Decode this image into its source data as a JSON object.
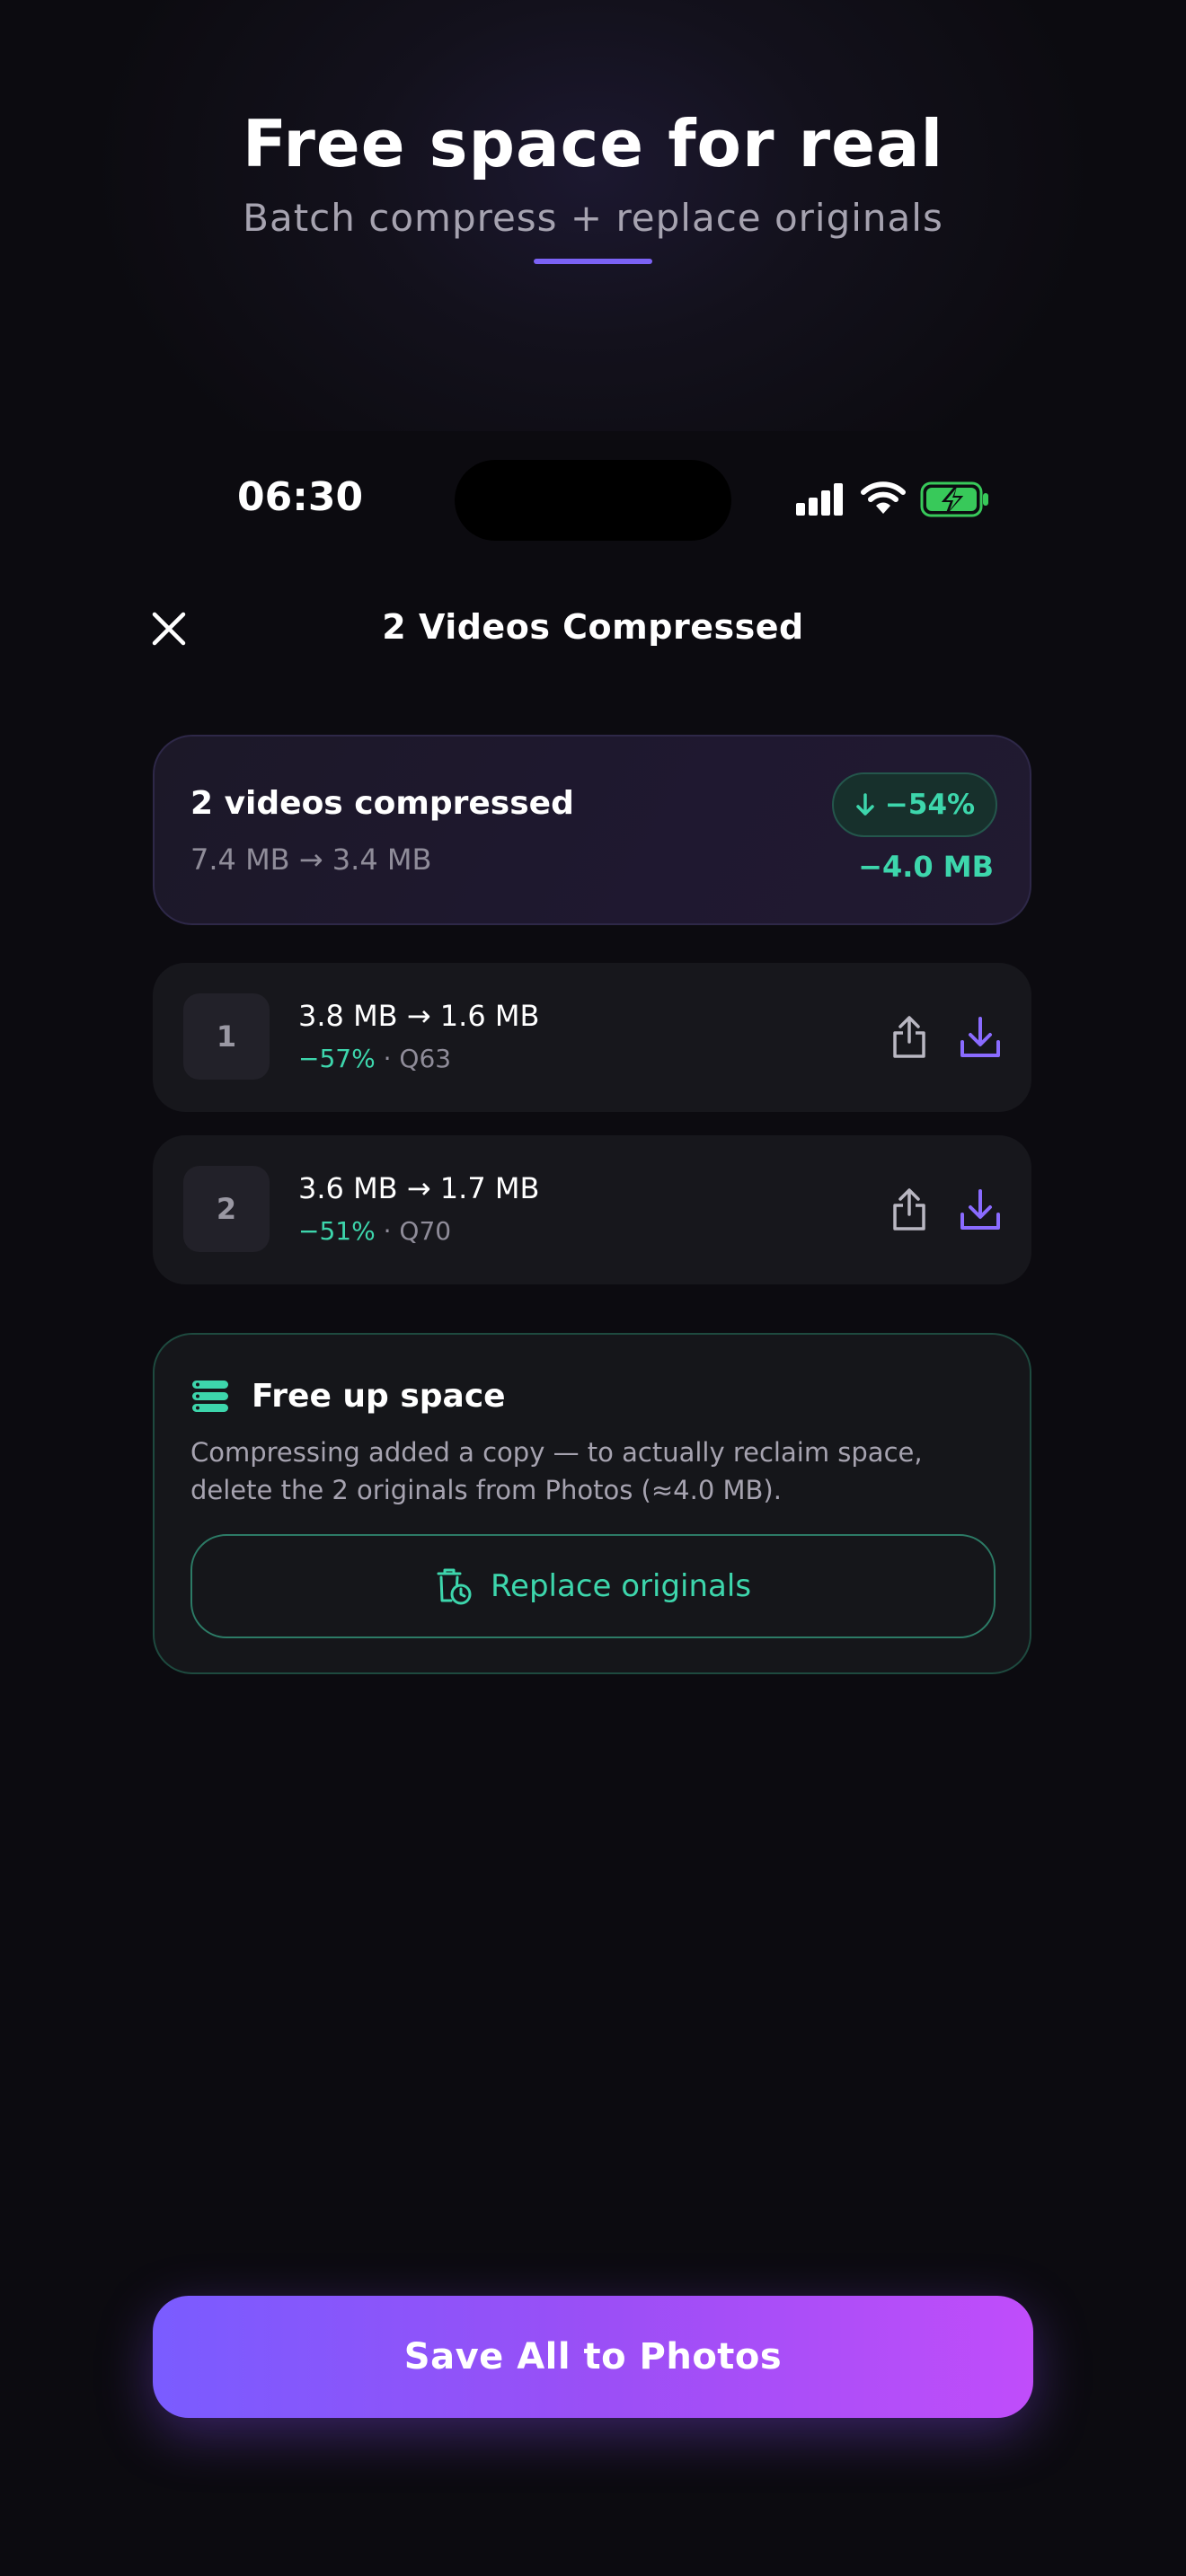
{
  "hero": {
    "title": "Free space for real",
    "subtitle": "Batch compress + replace originals"
  },
  "status_bar": {
    "time": "06:30",
    "icons": [
      "cellular-signal-icon",
      "wifi-icon",
      "battery-charging-icon"
    ]
  },
  "nav": {
    "close_icon": "close-icon",
    "title": "2 Videos Compressed"
  },
  "summary": {
    "title": "2 videos compressed",
    "sizes": "7.4 MB → 3.4 MB",
    "badge_icon": "arrow-down-icon",
    "badge_text": "−54%",
    "saved": "−4.0 MB"
  },
  "videos": [
    {
      "index": "1",
      "sizes": "3.8 MB → 1.6 MB",
      "percent": "−57%",
      "separator": " · ",
      "quality": "Q63"
    },
    {
      "index": "2",
      "sizes": "3.6 MB → 1.7 MB",
      "percent": "−51%",
      "separator": " · ",
      "quality": "Q70"
    }
  ],
  "free_space": {
    "icon": "storage-icon",
    "title": "Free up space",
    "description": "Compressing added a copy — to actually reclaim space, delete the 2 originals from Photos (≈4.0 MB).",
    "button_icon": "trash-clock-icon",
    "button_label": "Replace originals"
  },
  "save_button": {
    "label": "Save All to Photos"
  },
  "colors": {
    "background": "#0c0b10",
    "accent_green": "#3dd6ac",
    "accent_purple": "#7b62f5",
    "gradient_start": "#7a5cff",
    "gradient_end": "#c04dfa"
  }
}
